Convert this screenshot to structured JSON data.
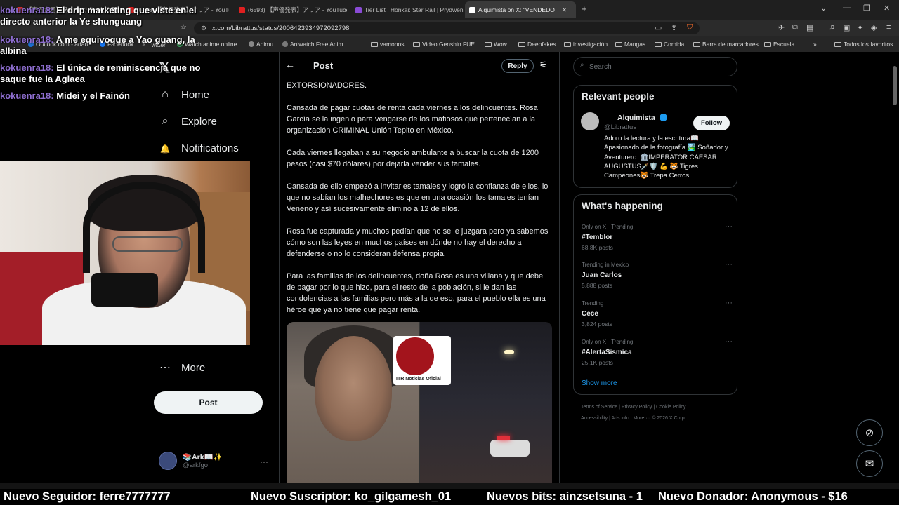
{
  "browser": {
    "tabs": [
      {
        "label": "【実況企画】 みんなでまったり配信...",
        "color": "#d33"
      },
      {
        "label": "(6593) 【声優発表】アリア - YouTube",
        "color": "#e02020"
      },
      {
        "label": "(6593) 【声優発表】アリア - YouTube",
        "color": "#e02020"
      },
      {
        "label": "Tier List | Honkai: Star Rail | Prydwen",
        "color": "#8a4bd6"
      },
      {
        "label": "Alquimista  on X: \"VENDEDO",
        "color": "#ffffff"
      }
    ],
    "new_tab": "+",
    "window_controls": [
      "⌄",
      "—",
      "❐",
      "✕"
    ],
    "url": "x.com/Librattus/status/2006423934972092798",
    "bookmarks": [
      "Outlook.com - adan...",
      "Facebook",
      "Twitter",
      "Watch anime online...",
      "Animu",
      "Aniwatch Free Anim...",
      "vamonos",
      "Video Genshin FUE...",
      "Wow",
      "Deepfakes",
      "investigación",
      "Mangas",
      "Comida",
      "Barra de marcadores",
      "Escuela",
      "Todos los favoritos"
    ]
  },
  "nav": {
    "logo": "𝕏",
    "items": [
      {
        "label": "Home",
        "icon": "⌂"
      },
      {
        "label": "Explore",
        "icon": "⌕"
      },
      {
        "label": "Notifications",
        "icon": "🔔"
      },
      {
        "label": "More",
        "icon": "⋯"
      }
    ],
    "post_button": "Post",
    "account": {
      "name": "📚Ark📖✨",
      "handle": "@arkfgo",
      "more": "···"
    }
  },
  "post": {
    "header_title": "Post",
    "reply_button": "Reply",
    "paragraphs": [
      "EXTORSIONADORES.",
      "Cansada de pagar cuotas de renta cada viernes a los delincuentes. Rosa García se la ingenió para vengarse de los mafiosos qué pertenecían a la organización CRIMINAL Unión Tepito en México.",
      "Cada viernes llegaban a su negocio ambulante a buscar la cuota de 1200 pesos (casi $70 dólares) por dejarla vender sus tamales.",
      "Cansada de ello empezó a invitarles tamales y logró la confianza de ellos, lo que no sabían los malhechores es que en una ocasión los tamales tenían Veneno y así sucesivamente eliminó a 12 de ellos.",
      "Rosa fue capturada y muchos pedían que no se le juzgara pero ya sabemos cómo son las leyes en muchos países en dónde no hay el derecho a defenderse o no lo consideran defensa propia.",
      "Para las familias de los delincuentes, doña Rosa es una villana y que debe de pagar por lo que hizo, para el resto de la población, si le dan las condolencias a las familias pero más a la de eso, para el pueblo ella es una héroe que ya no tiene que pagar renta."
    ],
    "media_badge": "ITR Noticias Oficial"
  },
  "sidebar": {
    "search_placeholder": "Search",
    "relevant_title": "Relevant people",
    "person": {
      "name": "Alquimista",
      "handle": "@Librattus",
      "follow": "Follow",
      "bio": "Adoro la lectura y la escritura📖 Apasionado de la fotografía 🏞️ Soñador y Aventurero. 🏛️IMPERATOR CAESAR AUGUSTUS🗡️🛡️ 💪 🐯 Tigres Campeones🐯 Trepa Cerros"
    },
    "happening_title": "What's happening",
    "trends": [
      {
        "context": "Only on X · Trending",
        "name": "#Temblor",
        "count": "68.8K posts"
      },
      {
        "context": "Trending in Mexico",
        "name": "Juan Carlos",
        "count": "5,888 posts"
      },
      {
        "context": "Trending",
        "name": "Cece",
        "count": "3,824 posts"
      },
      {
        "context": "Only on X · Trending",
        "name": "#AlertaSismica",
        "count": "25.1K posts"
      }
    ],
    "show_more": "Show more",
    "footer_line1": "Terms of Service  |  Privacy Policy  |  Cookie Policy  |",
    "footer_line2": "Accessibility  |  Ads info  |  More ···  © 2026 X Corp."
  },
  "chat": [
    {
      "user": "kokuenra18:",
      "message": "El drip marketing que viste en el directo anterior la Ye shunguang"
    },
    {
      "user": "kokuenra18:",
      "message": "A me equivoque a Yao guang, la albina"
    },
    {
      "user": "kokuenra18:",
      "message": "El única de reminiscencia que no saque fue la Aglaea"
    },
    {
      "user": "kokuenra18:",
      "message": "Midei y el Fainón"
    }
  ],
  "ticker": [
    "Nuevo Seguidor: ferre7777777",
    "Nuevo Suscriptor: ko_gilgamesh_01",
    "Nuevos bits: ainzsetsuna - 1",
    "Nuevo Donador: Anonymous - $16"
  ],
  "colors": {
    "accent": "#1d9bf0",
    "chat_user": "#8f6fd1",
    "background": "#000000"
  }
}
